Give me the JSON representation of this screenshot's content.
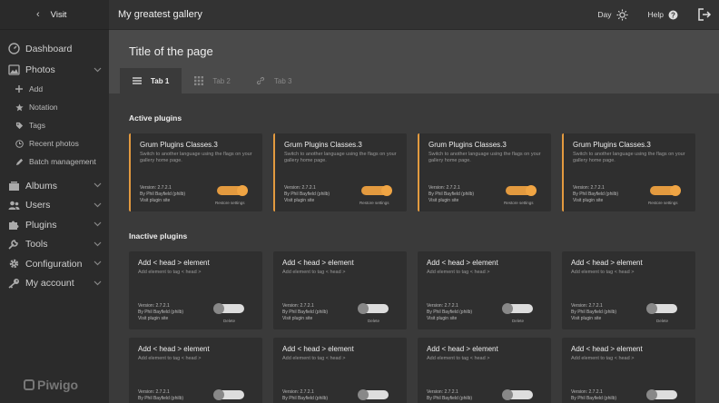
{
  "sidebar": {
    "visit_label": "Visit",
    "items": [
      {
        "label": "Dashboard"
      },
      {
        "label": "Photos"
      },
      {
        "label": "Albums"
      },
      {
        "label": "Users"
      },
      {
        "label": "Plugins"
      },
      {
        "label": "Tools"
      },
      {
        "label": "Configuration"
      },
      {
        "label": "My account"
      }
    ],
    "photos_sub": [
      {
        "label": "Add"
      },
      {
        "label": "Notation"
      },
      {
        "label": "Tags"
      },
      {
        "label": "Recent photos"
      },
      {
        "label": "Batch management"
      }
    ],
    "logo": "Piwigo"
  },
  "topbar": {
    "gallery_title": "My greatest gallery",
    "day_label": "Day",
    "help_label": "Help"
  },
  "header": {
    "page_title": "Title of the page",
    "tabs": [
      {
        "label": "Tab 1"
      },
      {
        "label": "Tab 2"
      },
      {
        "label": "Tab 3"
      }
    ]
  },
  "main": {
    "active_title": "Active plugins",
    "inactive_title": "Inactive plugins",
    "active_cards": [
      {
        "title": "Grum Plugins Classes.3",
        "desc": "Switch to another language using the flags on your gallery home page.",
        "version": "Version: 2.7.2.1",
        "author": "By Phil Bayfield (philb)",
        "site": "Visit plugin site",
        "toggle_label": "Restore settings"
      },
      {
        "title": "Grum Plugins Classes.3",
        "desc": "Switch to another language using the flags on your gallery home page.",
        "version": "Version: 2.7.2.1",
        "author": "By Phil Bayfield (philb)",
        "site": "Visit plugin site",
        "toggle_label": "Restore settings"
      },
      {
        "title": "Grum Plugins Classes.3",
        "desc": "Switch to another language using the flags on your gallery home page.",
        "version": "Version: 2.7.2.1",
        "author": "By Phil Bayfield (philb)",
        "site": "Visit plugin site",
        "toggle_label": "Restore settings"
      },
      {
        "title": "Grum Plugins Classes.3",
        "desc": "Switch to another language using the flags on your gallery home page.",
        "version": "Version: 2.7.2.1",
        "author": "By Phil Bayfield (philb)",
        "site": "Visit plugin site",
        "toggle_label": "Restore settings"
      }
    ],
    "inactive_cards": [
      {
        "title": "Add < head > element",
        "desc": "Add element to tag < head >",
        "version": "Version: 2.7.2.1",
        "author": "By Phil Bayfield (philb)",
        "site": "Visit plugin site",
        "toggle_label": "Delete"
      },
      {
        "title": "Add < head > element",
        "desc": "Add element to tag < head >",
        "version": "Version: 2.7.2.1",
        "author": "By Phil Bayfield (philb)",
        "site": "Visit plugin site",
        "toggle_label": "Delete"
      },
      {
        "title": "Add < head > element",
        "desc": "Add element to tag < head >",
        "version": "Version: 2.7.2.1",
        "author": "By Phil Bayfield (philb)",
        "site": "Visit plugin site",
        "toggle_label": "Delete"
      },
      {
        "title": "Add < head > element",
        "desc": "Add element to tag < head >",
        "version": "Version: 2.7.2.1",
        "author": "By Phil Bayfield (philb)",
        "site": "Visit plugin site",
        "toggle_label": "Delete"
      },
      {
        "title": "Add < head > element",
        "desc": "Add element to tag < head >",
        "version": "Version: 2.7.2.1",
        "author": "By Phil Bayfield (philb)",
        "site": "",
        "toggle_label": ""
      },
      {
        "title": "Add < head > element",
        "desc": "Add element to tag < head >",
        "version": "Version: 2.7.2.1",
        "author": "By Phil Bayfield (philb)",
        "site": "",
        "toggle_label": ""
      },
      {
        "title": "Add < head > element",
        "desc": "Add element to tag < head >",
        "version": "Version: 2.7.2.1",
        "author": "By Phil Bayfield (philb)",
        "site": "",
        "toggle_label": ""
      },
      {
        "title": "Add < head > element",
        "desc": "Add element to tag < head >",
        "version": "Version: 2.7.2.1",
        "author": "By Phil Bayfield (philb)",
        "site": "",
        "toggle_label": ""
      }
    ]
  },
  "colors": {
    "accent": "#e39a3f",
    "sidebar_bg": "#2b2b2b",
    "header_bg": "#4a4a4a",
    "card_bg": "#2f2f2f"
  }
}
